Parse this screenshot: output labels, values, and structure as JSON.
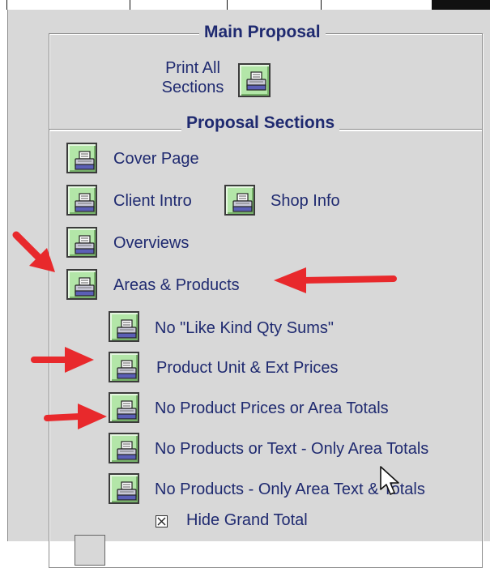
{
  "main_proposal": {
    "title": "Main Proposal",
    "print_all_line1": "Print All",
    "print_all_line2": "Sections"
  },
  "proposal_sections": {
    "title": "Proposal Sections",
    "cover_page": "Cover Page",
    "client_intro": "Client Intro",
    "shop_info": "Shop Info",
    "overviews": "Overviews",
    "areas_products": "Areas & Products",
    "sub_options": [
      "No \"Like Kind Qty Sums\"",
      "Product Unit & Ext Prices",
      "No Product Prices or Area Totals",
      "No Products or Text - Only Area Totals",
      "No Products - Only Area Text & Totals"
    ],
    "hide_grand_total": {
      "label": "Hide Grand Total",
      "checked": true
    }
  },
  "icons": {
    "print_button": "printer-icon",
    "annotation": "red-arrow-annotation",
    "cursor": "mouse-pointer-cursor"
  },
  "colors": {
    "panel_bg": "#d8d8d8",
    "button_green": "#b3e6a8",
    "label_text": "#1f2a70",
    "arrow_red": "#e8292c"
  }
}
